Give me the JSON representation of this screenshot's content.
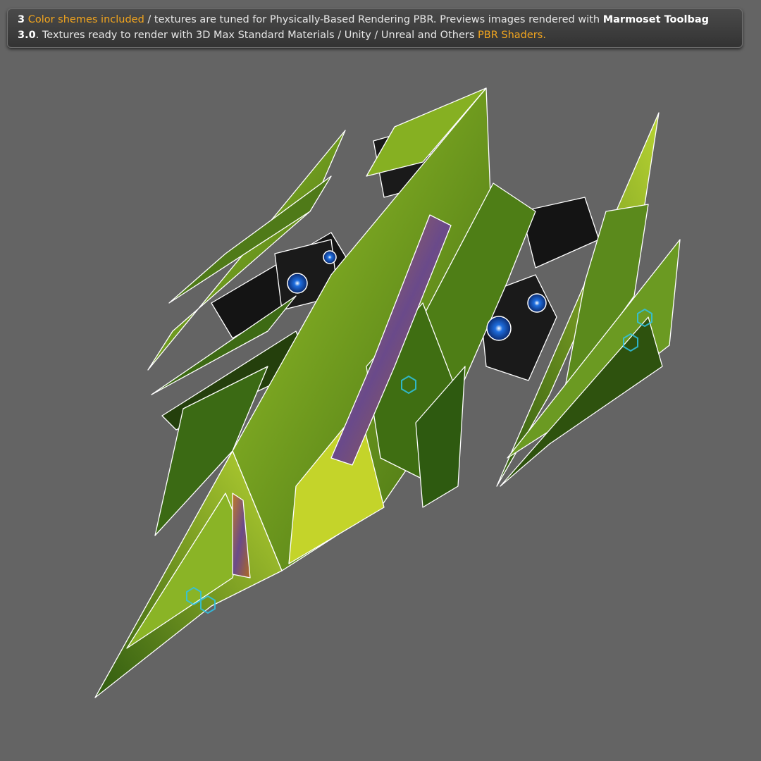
{
  "banner": {
    "count": "3",
    "schemes": "Color shemes included",
    "text1": " / textures are tuned for Physically-Based Rendering PBR. Previews images rendered with ",
    "toolbag": "Marmoset Toolbag 3.0",
    "text2": ". Textures ready to render with 3D Max Standard Materials / Unity / Unreal and Others ",
    "shaders": "PBR Shaders."
  },
  "colors": {
    "background": "#646464",
    "accent": "#f2a51e",
    "hull": "#5a8a1e",
    "wire": "#ffffff",
    "engine": "#1f6fe0"
  }
}
